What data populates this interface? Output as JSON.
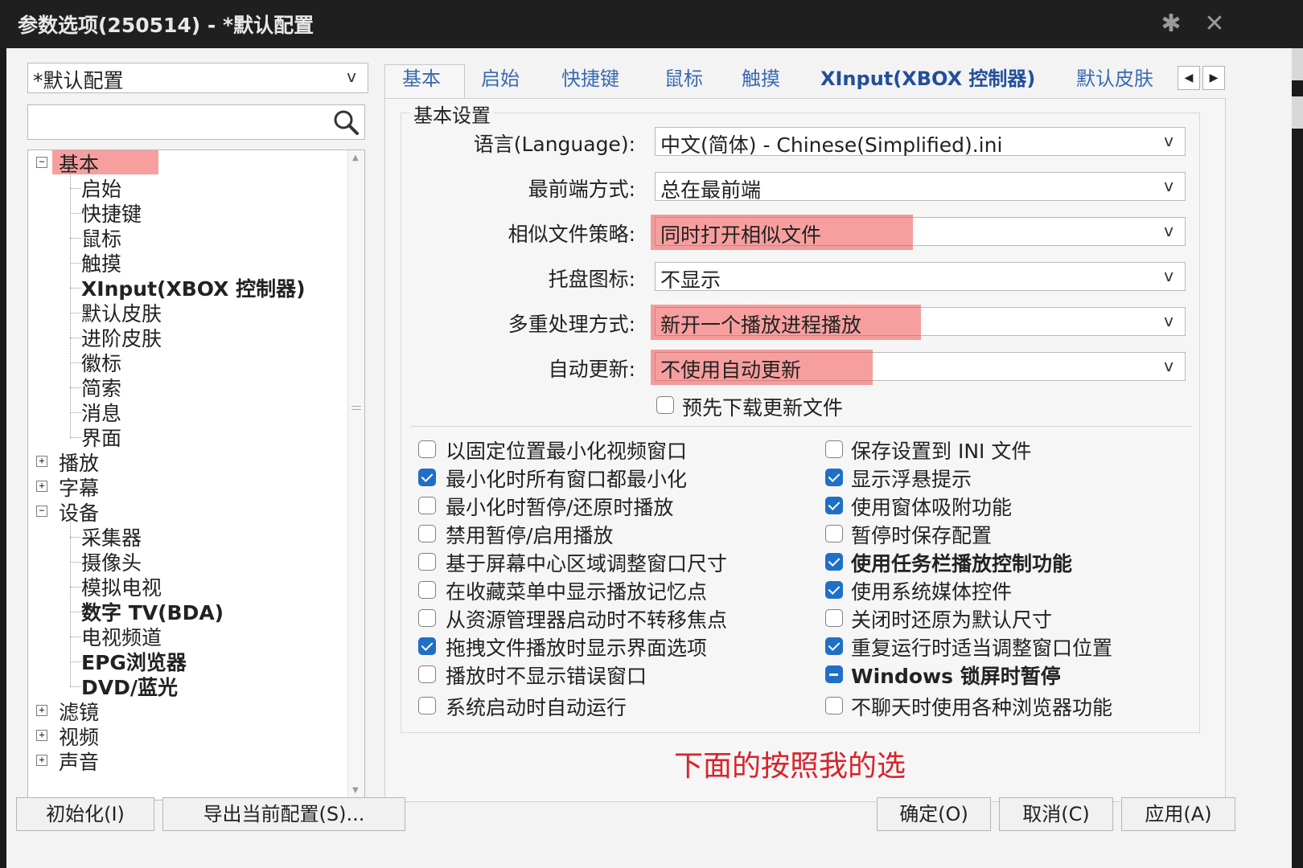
{
  "window": {
    "title": "参数选项(250514) - *默认配置",
    "pin_icon": "pin-icon",
    "close_icon": "close-icon"
  },
  "profile_select": {
    "value": "*默认配置",
    "arrow": "v"
  },
  "search": {
    "placeholder": "",
    "icon": "search-icon"
  },
  "tree": {
    "items": [
      {
        "label": "基本",
        "level": 0,
        "expander": "−",
        "bold": false,
        "highlight": true
      },
      {
        "label": "启始",
        "level": 1
      },
      {
        "label": "快捷键",
        "level": 1
      },
      {
        "label": "鼠标",
        "level": 1
      },
      {
        "label": "触摸",
        "level": 1
      },
      {
        "label": "XInput(XBOX 控制器)",
        "level": 1,
        "bold": true
      },
      {
        "label": "默认皮肤",
        "level": 1
      },
      {
        "label": "进阶皮肤",
        "level": 1
      },
      {
        "label": "徽标",
        "level": 1
      },
      {
        "label": "简索",
        "level": 1
      },
      {
        "label": "消息",
        "level": 1
      },
      {
        "label": "界面",
        "level": 1
      },
      {
        "label": "播放",
        "level": 0,
        "expander": "+"
      },
      {
        "label": "字幕",
        "level": 0,
        "expander": "+"
      },
      {
        "label": "设备",
        "level": 0,
        "expander": "−"
      },
      {
        "label": "采集器",
        "level": 1
      },
      {
        "label": "摄像头",
        "level": 1
      },
      {
        "label": "模拟电视",
        "level": 1
      },
      {
        "label": "数字 TV(BDA)",
        "level": 1,
        "bold": true
      },
      {
        "label": "电视频道",
        "level": 1
      },
      {
        "label": "EPG浏览器",
        "level": 1,
        "bold": true
      },
      {
        "label": "DVD/蓝光",
        "level": 1,
        "bold": true
      },
      {
        "label": "滤镜",
        "level": 0,
        "expander": "+"
      },
      {
        "label": "视频",
        "level": 0,
        "expander": "+"
      },
      {
        "label": "声音",
        "level": 0,
        "expander": "+"
      }
    ]
  },
  "tabs": [
    {
      "label": "基本",
      "active": true
    },
    {
      "label": "启始"
    },
    {
      "label": "快捷键"
    },
    {
      "label": "鼠标"
    },
    {
      "label": "触摸"
    },
    {
      "label": "XInput(XBOX 控制器)",
      "bold": true
    },
    {
      "label": "默认皮肤"
    }
  ],
  "tab_scroll": {
    "left": "◀",
    "right": "▶"
  },
  "group": {
    "title": "基本设置"
  },
  "fields": [
    {
      "label": "语言(Language):",
      "value": "中文(简体) - Chinese(Simplified).ini",
      "highlight": false
    },
    {
      "label": "最前端方式:",
      "value": "总在最前端",
      "highlight": false
    },
    {
      "label": "相似文件策略:",
      "value": "同时打开相似文件",
      "highlight": true
    },
    {
      "label": "托盘图标:",
      "value": "不显示",
      "highlight": false
    },
    {
      "label": "多重处理方式:",
      "value": "新开一个播放进程播放",
      "highlight": true
    },
    {
      "label": "自动更新:",
      "value": "不使用自动更新",
      "highlight": true
    }
  ],
  "predownload": {
    "label": "预先下载更新文件",
    "checked": false
  },
  "checks_left": [
    {
      "label": "以固定位置最小化视频窗口",
      "state": "off"
    },
    {
      "label": "最小化时所有窗口都最小化",
      "state": "on"
    },
    {
      "label": "最小化时暂停/还原时播放",
      "state": "off"
    },
    {
      "label": "禁用暂停/启用播放",
      "state": "off"
    },
    {
      "label": "基于屏幕中心区域调整窗口尺寸",
      "state": "off"
    },
    {
      "label": "在收藏菜单中显示播放记忆点",
      "state": "off"
    },
    {
      "label": "从资源管理器启动时不转移焦点",
      "state": "off"
    },
    {
      "label": "拖拽文件播放时显示界面选项",
      "state": "on"
    },
    {
      "label": "播放时不显示错误窗口",
      "state": "off"
    },
    {
      "label": "系统启动时自动运行",
      "state": "off"
    }
  ],
  "checks_right": [
    {
      "label": "保存设置到 INI 文件",
      "state": "off"
    },
    {
      "label": "显示浮悬提示",
      "state": "on"
    },
    {
      "label": "使用窗体吸附功能",
      "state": "on"
    },
    {
      "label": "暂停时保存配置",
      "state": "off"
    },
    {
      "label": "使用任务栏播放控制功能",
      "state": "on",
      "bold": true
    },
    {
      "label": "使用系统媒体控件",
      "state": "on"
    },
    {
      "label": "关闭时还原为默认尺寸",
      "state": "off"
    },
    {
      "label": "重复运行时适当调整窗口位置",
      "state": "on"
    },
    {
      "label": "Windows 锁屏时暂停",
      "state": "indeterminate",
      "bold": true
    },
    {
      "label": "不聊天时使用各种浏览器功能",
      "state": "off"
    }
  ],
  "annotation": "下面的按照我的选",
  "buttons": {
    "init": "初始化(I)",
    "export": "导出当前配置(S)...",
    "ok": "确定(O)",
    "cancel": "取消(C)",
    "apply": "应用(A)"
  },
  "colors": {
    "accent": "#1f6fc7",
    "highlight": "#f05050",
    "annotation": "#d9232a"
  }
}
